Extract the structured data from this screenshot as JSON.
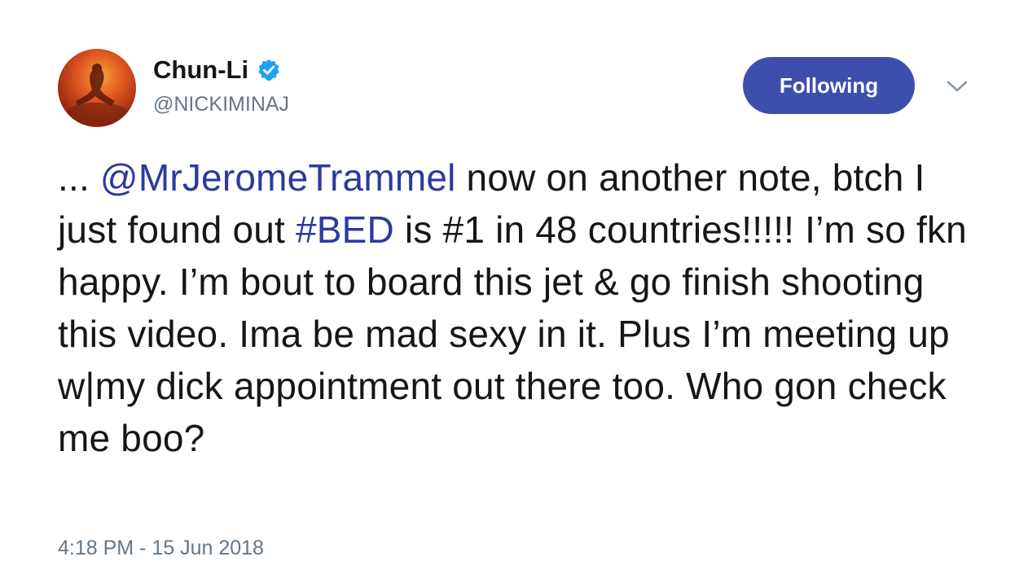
{
  "author": {
    "display_name": "Chun-Li",
    "handle": "@NICKIMINAJ",
    "verified": true,
    "avatar_icon": "profile-photo"
  },
  "actions": {
    "follow_label": "Following",
    "menu_icon": "chevron-down-icon"
  },
  "colors": {
    "follow_button_bg": "#3d4fad",
    "link": "#2b3a9e",
    "verified": "#1da1f2",
    "secondary_text": "#657786"
  },
  "tweet": {
    "prefix": "... ",
    "mention": "@MrJeromeTrammel",
    "segment_1": " now on another note, btch I just found out ",
    "hashtag": "#BED",
    "segment_2": " is #1 in 48 countries!!!!! I’m so fkn happy. I’m bout to board this jet & go finish shooting this video. Ima be mad sexy in it. Plus I’m meeting up w|my dick appointment out there too. Who gon check me boo?"
  },
  "timestamp": "4:18 PM - 15 Jun 2018"
}
